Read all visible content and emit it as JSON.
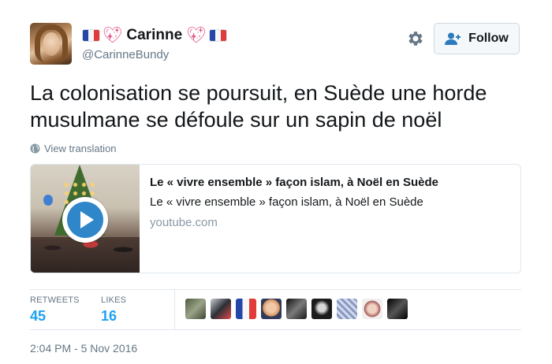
{
  "author": {
    "display_name": "Carinne",
    "handle": "@CarinneBundy",
    "avatar_icon": "profile-photo"
  },
  "follow_button": {
    "label": "Follow",
    "icon": "add-user-icon"
  },
  "settings_icon": "gear-icon",
  "tweet": {
    "text": "La colonisation se poursuit, en Suède une horde musulmane se défoule sur un sapin de noël",
    "view_translation": "View translation"
  },
  "card": {
    "title": "Le « vivre ensemble » façon islam, à Noël en Suède",
    "description": "Le « vivre ensemble » façon islam, à Noël en Suède",
    "domain": "youtube.com",
    "thumbnail_icon": "video-play-icon"
  },
  "stats": {
    "retweets_label": "RETWEETS",
    "retweets_value": "45",
    "likes_label": "LIKES",
    "likes_value": "16"
  },
  "liker_avatars_count": 9,
  "timestamp": "2:04 PM - 5 Nov 2016",
  "colors": {
    "accent": "#1da1f2",
    "muted": "#657786",
    "text": "#14171a",
    "border": "#e1e8ed"
  }
}
